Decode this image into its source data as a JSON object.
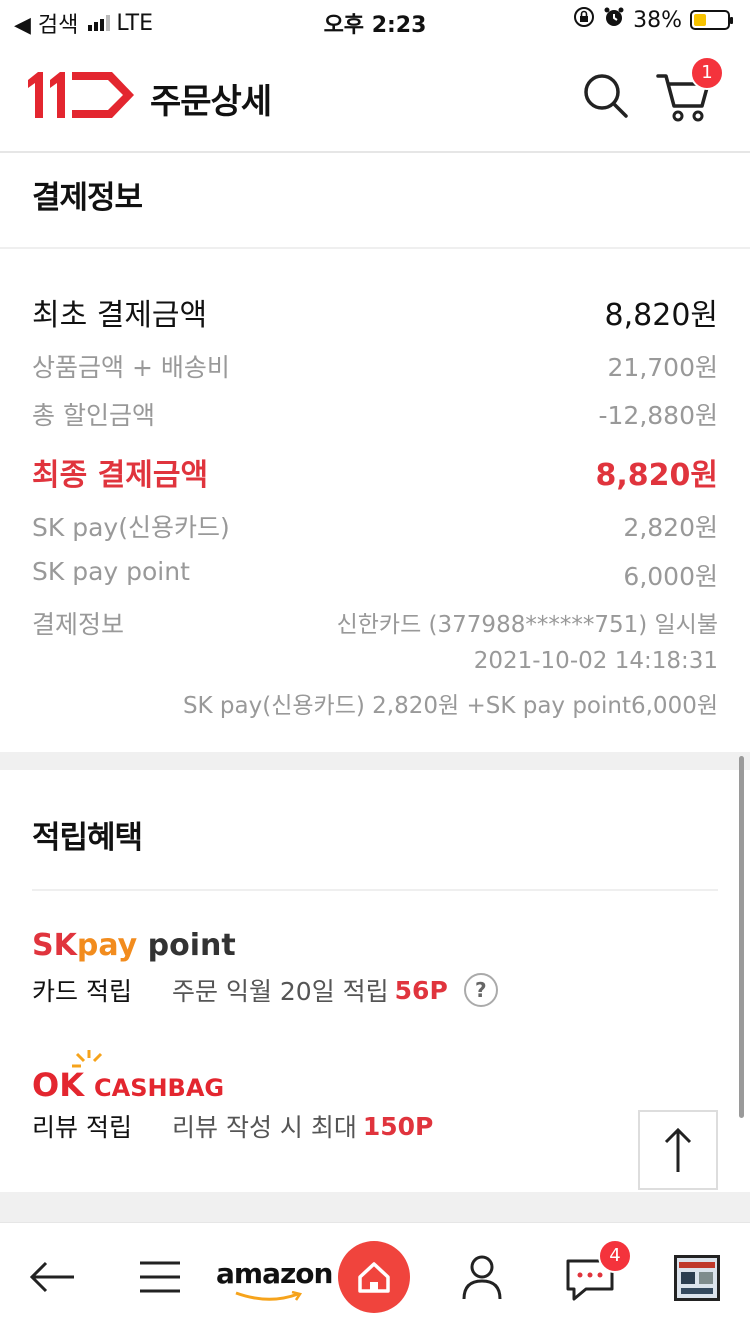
{
  "status_bar": {
    "back_label": "◀ 검색",
    "network": "LTE",
    "time": "오후 2:23",
    "battery_percent": "38%",
    "battery_level": 0.38
  },
  "header": {
    "title": "주문상세",
    "cart_count": "1"
  },
  "payment": {
    "section_title": "결제정보",
    "initial": {
      "label": "최초 결제금액",
      "value": "8,820원"
    },
    "product_shipping": {
      "label": "상품금액 + 배송비",
      "value": "21,700원"
    },
    "discount": {
      "label": "총 할인금액",
      "value": "-12,880원"
    },
    "final": {
      "label": "최종 결제금액",
      "value": "8,820원"
    },
    "skpay_card": {
      "label": "SK pay(신용카드)",
      "value": "2,820원"
    },
    "skpay_point": {
      "label": "SK pay point",
      "value": "6,000원"
    },
    "info": {
      "label": "결제정보",
      "card": "신한카드 (377988******751) 일시불",
      "datetime": "2021-10-02 14:18:31",
      "breakdown": "SK pay(신용카드) 2,820원 +SK pay point6,000원"
    }
  },
  "benefits": {
    "section_title": "적립혜택",
    "skpay": {
      "logo_sk": "SK",
      "logo_pay": "pay",
      "logo_point": "point",
      "label": "카드 적립",
      "desc": "주문 익월 20일 적립",
      "points": "56P",
      "help": "?"
    },
    "okcashbag": {
      "logo_ok": "OK",
      "logo_cb": "CASHBAG",
      "label": "리뷰 적립",
      "desc": "리뷰 작성 시 최대",
      "points": "150P"
    }
  },
  "tabbar": {
    "amazon_label": "amazon",
    "chat_count": "4"
  },
  "colors": {
    "accent": "#e0343d",
    "brand_red": "#f0443d"
  }
}
